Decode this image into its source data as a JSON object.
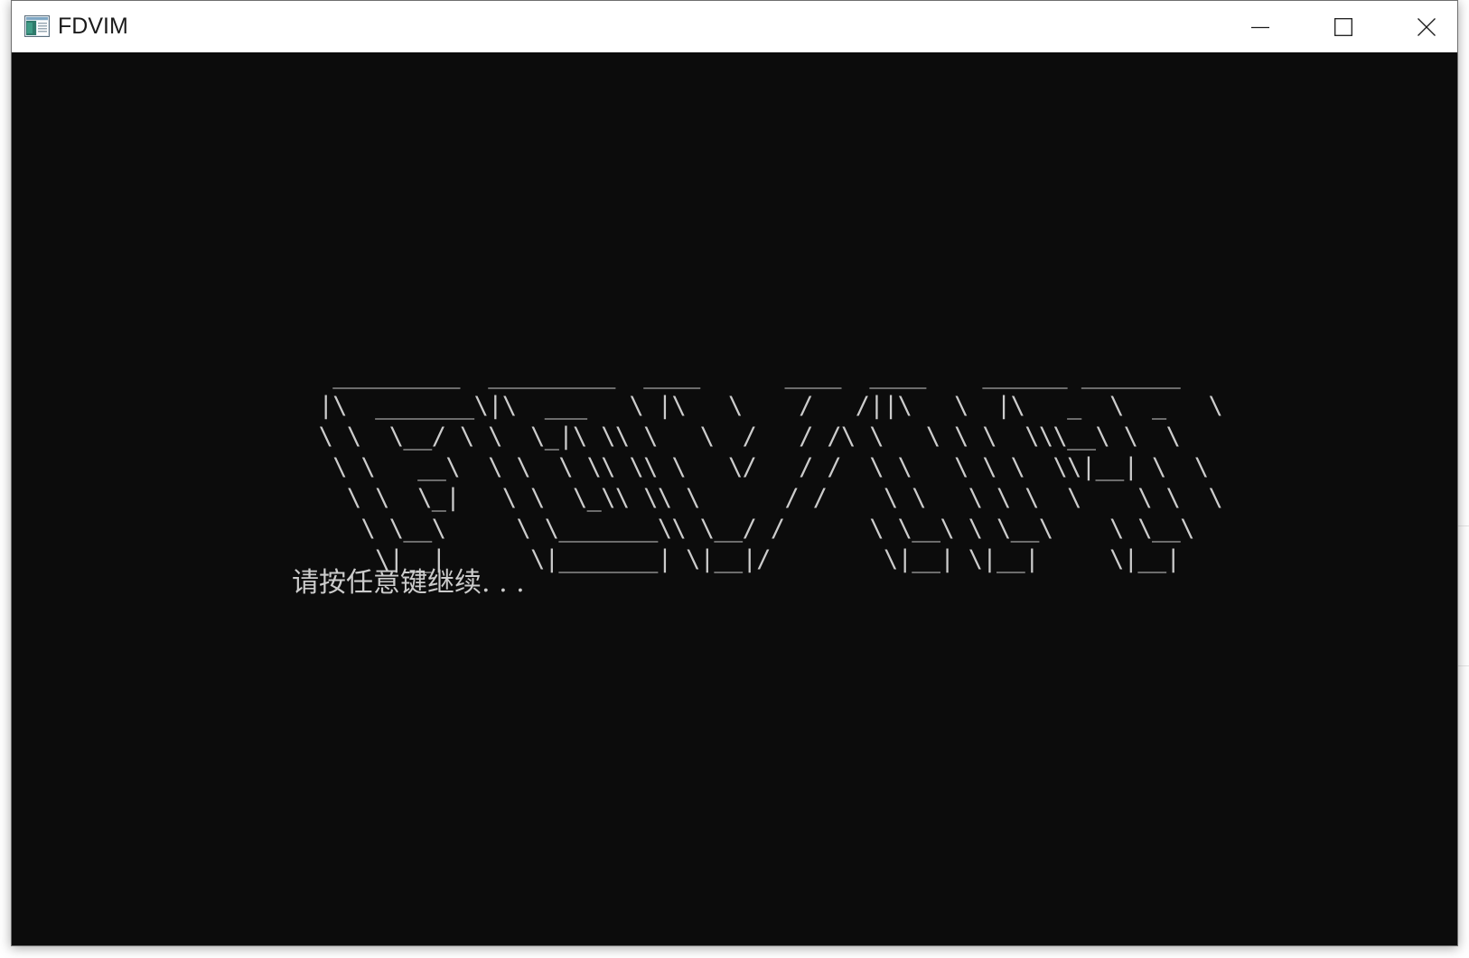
{
  "window": {
    "title": "FDVIM",
    "controls": {
      "minimize": "minimize",
      "maximize": "maximize",
      "close": "close"
    }
  },
  "console": {
    "ascii_banner": "  _________  _________  ____      ____  ____    ______ _______\n |\\  _______\\|\\  ___   \\ |\\   \\    /   /||\\   \\  |\\   _  \\  _   \\\n \\ \\  \\__/ \\ \\  \\_|\\ \\\\ \\   \\  /   / /\\ \\   \\ \\ \\  \\\\\\__\\ \\  \\\n  \\ \\   __\\  \\ \\  \\ \\\\ \\\\ \\   \\/   / /  \\ \\   \\ \\ \\  \\\\|__| \\  \\\n   \\ \\  \\_|   \\ \\  \\_\\\\ \\\\ \\      / /    \\ \\   \\ \\ \\  \\    \\ \\  \\\n    \\ \\__\\     \\ \\_______\\\\ \\__/ /      \\ \\__\\ \\ \\__\\    \\ \\__\\\n     \\|__|      \\|_______| \\|__|/        \\|__| \\|__|     \\|__|",
    "prompt": "请按任意键继续. . ."
  },
  "colors": {
    "console_bg": "#0c0c0c",
    "console_fg": "#cccccc",
    "titlebar_bg": "#ffffff"
  }
}
